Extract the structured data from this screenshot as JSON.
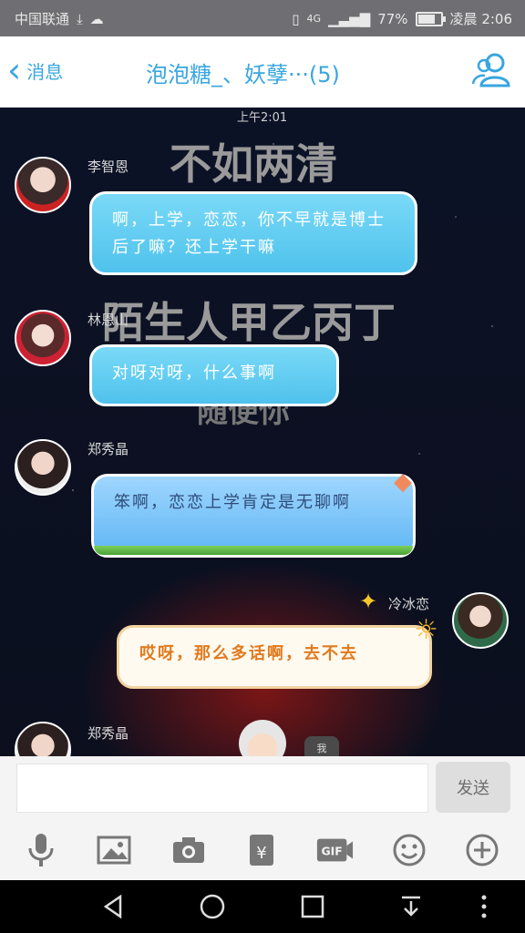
{
  "status_bar": {
    "carrier": "中国联通",
    "network": "4G",
    "battery_text": "77%",
    "battery_level": 0.77,
    "time": "凌晨 2:06"
  },
  "header": {
    "back_label": "消息",
    "title": "泡泡糖_、妖孽···(5)"
  },
  "chat": {
    "timestamp": "上午2:01",
    "background_texts": [
      "不如两清",
      "陌生人甲乙丙丁",
      "随便你"
    ],
    "messages": [
      {
        "sender": "李智恩",
        "text": "啊，上学，恋恋，你不早就是博士后了嘛？还上学干嘛"
      },
      {
        "sender": "林恩山",
        "text": "对呀对呀，什么事啊"
      },
      {
        "sender": "郑秀晶",
        "text": "笨啊，恋恋上学肯定是无聊啊"
      },
      {
        "sender": "冷冰恋",
        "text": "哎呀，那么多话啊，去不去"
      },
      {
        "sender": "郑秀晶",
        "text": "我"
      }
    ]
  },
  "input": {
    "placeholder": "",
    "send_label": "发送"
  },
  "toolbar_icons": [
    "microphone-icon",
    "image-icon",
    "camera-icon",
    "red-packet-icon",
    "gif-icon",
    "emoji-icon",
    "plus-icon"
  ],
  "colors": {
    "accent": "#39a6df",
    "bubble_blue": "#5cc7ef",
    "bubble_cream_text": "#e07a1e"
  }
}
